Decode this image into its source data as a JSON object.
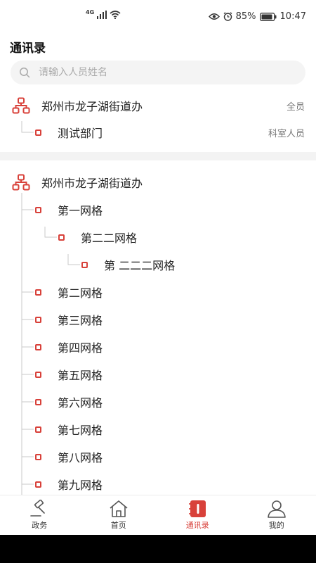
{
  "status_bar": {
    "signal_label": "4G",
    "battery_percent": "85%",
    "time": "10:47"
  },
  "page": {
    "title": "通讯录"
  },
  "search": {
    "placeholder": "请输入人员姓名"
  },
  "section1": {
    "org_name": "郑州市龙子湖街道办",
    "org_tag": "全员",
    "items": [
      {
        "label": "测试部门",
        "tag": "科室人员"
      }
    ]
  },
  "section2": {
    "org_name": "郑州市龙子湖街道办",
    "items": [
      {
        "label": "第一网格"
      },
      {
        "label": "第二二网格"
      },
      {
        "label": "第 二二二网格"
      },
      {
        "label": "第二网格"
      },
      {
        "label": "第三网格"
      },
      {
        "label": "第四网格"
      },
      {
        "label": "第五网格"
      },
      {
        "label": "第六网格"
      },
      {
        "label": "第七网格"
      },
      {
        "label": "第八网格"
      },
      {
        "label": "第九网格"
      }
    ]
  },
  "tabs": [
    {
      "label": "政务",
      "icon": "gavel-icon",
      "active": false
    },
    {
      "label": "首页",
      "icon": "home-icon",
      "active": false
    },
    {
      "label": "通讯录",
      "icon": "contacts-icon",
      "active": true
    },
    {
      "label": "我的",
      "icon": "user-icon",
      "active": false
    }
  ],
  "colors": {
    "accent": "#d8413a",
    "text": "#222222",
    "muted": "#777777",
    "search_bg": "#f4f4f4",
    "band_bg": "#f3f3f3"
  }
}
